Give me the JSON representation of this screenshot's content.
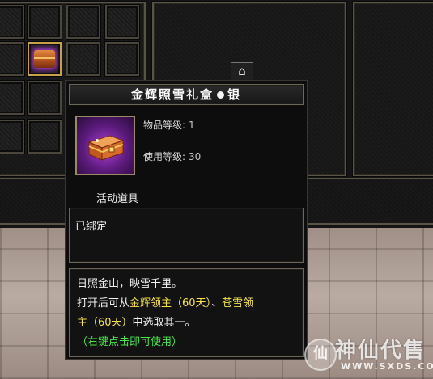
{
  "tooltip": {
    "title_left": "金辉照雪礼盒",
    "title_right": "银",
    "item_level_label": "物品等级:",
    "item_level_value": "1",
    "use_level_label": "使用等级:",
    "use_level_value": "30",
    "category": "活动道具",
    "bind_status": "已绑定",
    "desc_line1": "日照金山，映雪千里。",
    "desc_line2_pre": "打开后可从",
    "desc_line2_hl1": "金辉领主（60天）",
    "desc_line2_mid": "、",
    "desc_line2_hl2": "苍雪领",
    "desc_line3_hl": "主（60天）",
    "desc_line3_post": "中选取其一。",
    "desc_hint": "（右键点击即可使用）"
  },
  "watermark": {
    "seal": "仙",
    "text": "神仙代售",
    "url": "WWW.SXDS.COM"
  },
  "icons": {
    "item": "gift-chest-icon",
    "lock": "lock-icon"
  },
  "colors": {
    "highlight": "#f7e34a",
    "hint": "#47e64b",
    "frame": "#5a5446"
  }
}
